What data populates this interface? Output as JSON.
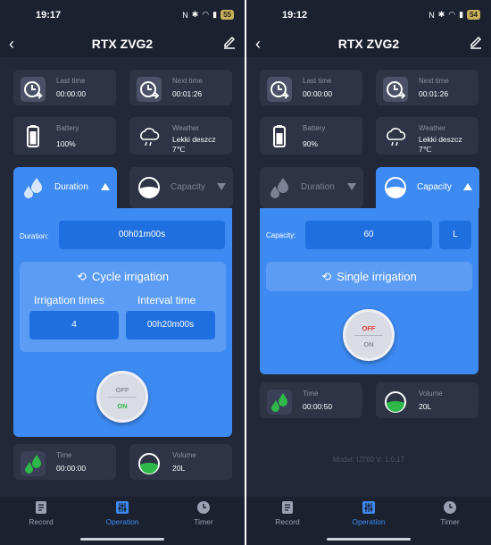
{
  "left": {
    "status": {
      "time": "19:17",
      "battery": "55"
    },
    "header": {
      "title": "RTX ZVG2"
    },
    "cards": {
      "last_time": {
        "label": "Last time",
        "value": "00:00:00"
      },
      "next_time": {
        "label": "Next time",
        "value": "00:01:26"
      },
      "battery": {
        "label": "Battery",
        "value": "100%"
      },
      "weather": {
        "label": "Weather",
        "value_line1": "Lekki deszcz",
        "value_line2": "7℃"
      }
    },
    "tabs": {
      "duration": "Duration",
      "capacity": "Capacity",
      "active": "duration"
    },
    "duration": {
      "label": "Duration:",
      "value": "00h01m00s"
    },
    "cycle": {
      "title": "Cycle irrigation",
      "irrigation_times_label": "Irrigation times",
      "interval_label": "Interval time",
      "irrigation_times": "4",
      "interval": "00h20m00s"
    },
    "toggle": {
      "off": "OFF",
      "on": "ON",
      "state": "on"
    },
    "bottom_cards": {
      "time": {
        "label": "Time",
        "value": "00:00:00"
      },
      "volume": {
        "label": "Volume",
        "value": "20L"
      }
    },
    "nav": {
      "record": "Record",
      "operation": "Operation",
      "timer": "Timer",
      "active": "operation"
    }
  },
  "right": {
    "status": {
      "time": "19:12",
      "battery": "54"
    },
    "header": {
      "title": "RTX ZVG2"
    },
    "cards": {
      "last_time": {
        "label": "Last time",
        "value": "00:00:00"
      },
      "next_time": {
        "label": "Next time",
        "value": "00:01:26"
      },
      "battery": {
        "label": "Battery",
        "value": "90%"
      },
      "weather": {
        "label": "Weather",
        "value_line1": "Lekki deszcz",
        "value_line2": "7℃"
      }
    },
    "tabs": {
      "duration": "Duration",
      "capacity": "Capacity",
      "active": "capacity"
    },
    "capacity": {
      "label": "Capacity:",
      "value": "60",
      "unit": "L"
    },
    "single": {
      "title": "Single irrigation"
    },
    "toggle": {
      "off": "OFF",
      "on": "ON",
      "state": "off"
    },
    "bottom_cards": {
      "time": {
        "label": "Time",
        "value": "00:00:50"
      },
      "volume": {
        "label": "Volume",
        "value": "20L"
      }
    },
    "model": "Model: IJT60 V: 1.0.17",
    "nav": {
      "record": "Record",
      "operation": "Operation",
      "timer": "Timer",
      "active": "operation"
    }
  },
  "colors": {
    "accent": "#3d8af2",
    "background": "#232838",
    "card": "#2e3446",
    "toggle_on": "#2fb84a",
    "toggle_off": "#e23b3b"
  }
}
